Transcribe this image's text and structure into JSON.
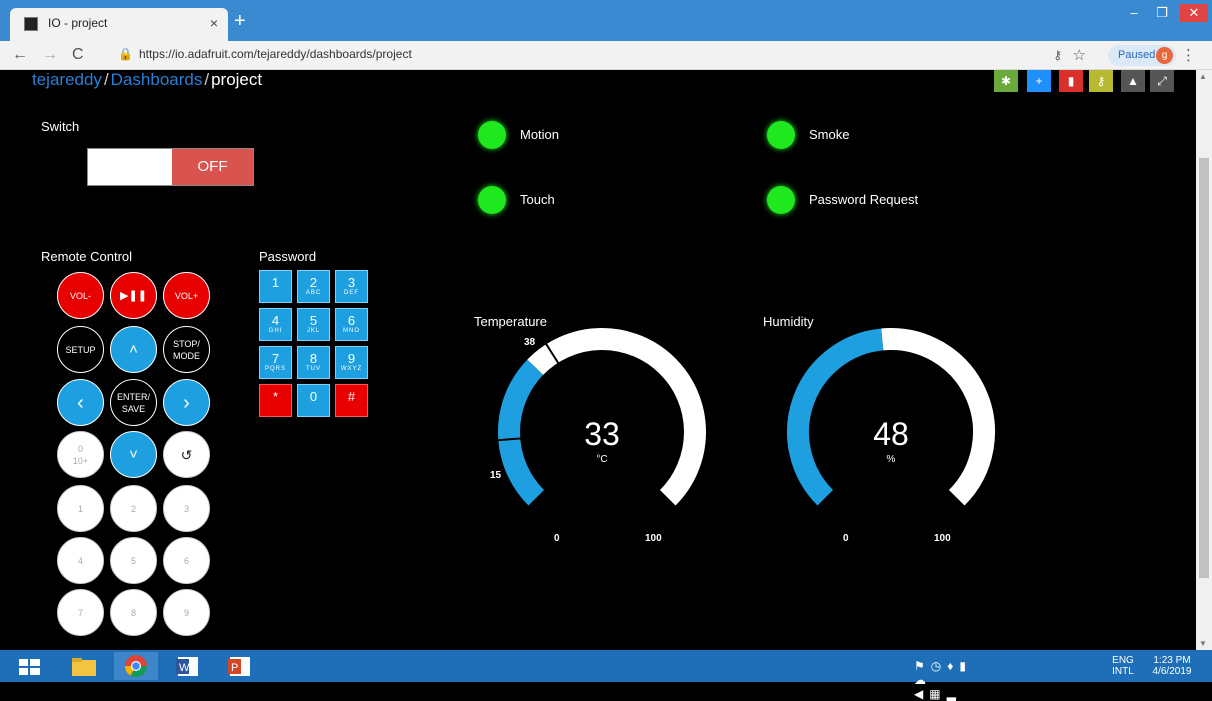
{
  "browser": {
    "tab_title": "IO - project",
    "tab_close": "×",
    "new_tab": "+",
    "url": "https://io.adafruit.com/tejareddy/dashboards/project",
    "paused_label": "Paused",
    "profile_initial": "g",
    "back": "←",
    "forward": "→",
    "reload": "C",
    "minimize": "–",
    "restore": "❐",
    "close": "✕"
  },
  "breadcrumb": {
    "user": "tejareddy",
    "sep": "/",
    "section": "Dashboards",
    "page": "project"
  },
  "toolbar": {
    "colors": [
      "#6aaa3a",
      "#1e90ff",
      "#d9302c",
      "#b8b832",
      "#555555",
      "#555555"
    ],
    "icons": [
      "gear-icon",
      "plus-icon",
      "trash-icon",
      "key-icon",
      "lock-icon",
      "expand-icon"
    ]
  },
  "switch": {
    "label": "Switch",
    "state": "OFF"
  },
  "indicators": [
    {
      "label": "Motion",
      "color": "#1fe81f"
    },
    {
      "label": "Smoke",
      "color": "#1fe81f"
    },
    {
      "label": "Touch",
      "color": "#1fe81f"
    },
    {
      "label": "Password Request",
      "color": "#1fe81f"
    }
  ],
  "remote": {
    "label": "Remote Control",
    "vol_down": "VOL-",
    "play_pause": "▶❚❚",
    "vol_up": "VOL+",
    "setup": "SETUP",
    "up": "˄",
    "stop_mode": "STOP/ MODE",
    "left": "‹",
    "enter_save": "ENTER/ SAVE",
    "right": "›",
    "zero_ten_top": "0",
    "zero_ten_bottom": "10+",
    "down": "˅",
    "back": "↺",
    "digits": [
      "1",
      "2",
      "3",
      "4",
      "5",
      "6",
      "7",
      "8",
      "9"
    ]
  },
  "password": {
    "label": "Password",
    "keys": [
      {
        "d": "1",
        "s": ""
      },
      {
        "d": "2",
        "s": "ABC"
      },
      {
        "d": "3",
        "s": "DEF"
      },
      {
        "d": "4",
        "s": "GHI"
      },
      {
        "d": "5",
        "s": "JKL"
      },
      {
        "d": "6",
        "s": "MNO"
      },
      {
        "d": "7",
        "s": "PQRS"
      },
      {
        "d": "8",
        "s": "TUV"
      },
      {
        "d": "9",
        "s": "WXYZ"
      },
      {
        "d": "*",
        "s": ""
      },
      {
        "d": "0",
        "s": ""
      },
      {
        "d": "#",
        "s": ""
      }
    ]
  },
  "temperature": {
    "title": "Temperature",
    "value": "33",
    "unit": "°C",
    "min": "0",
    "max": "100",
    "low_mark": "15",
    "high_mark": "38",
    "color": "#1ea0e0"
  },
  "humidity": {
    "title": "Humidity",
    "value": "48",
    "unit": "%",
    "min": "0",
    "max": "100",
    "color": "#1ea0e0"
  },
  "tray": {
    "lang_top": "ENG",
    "lang_bottom": "INTL",
    "time": "1:23 PM",
    "date": "4/6/2019"
  }
}
